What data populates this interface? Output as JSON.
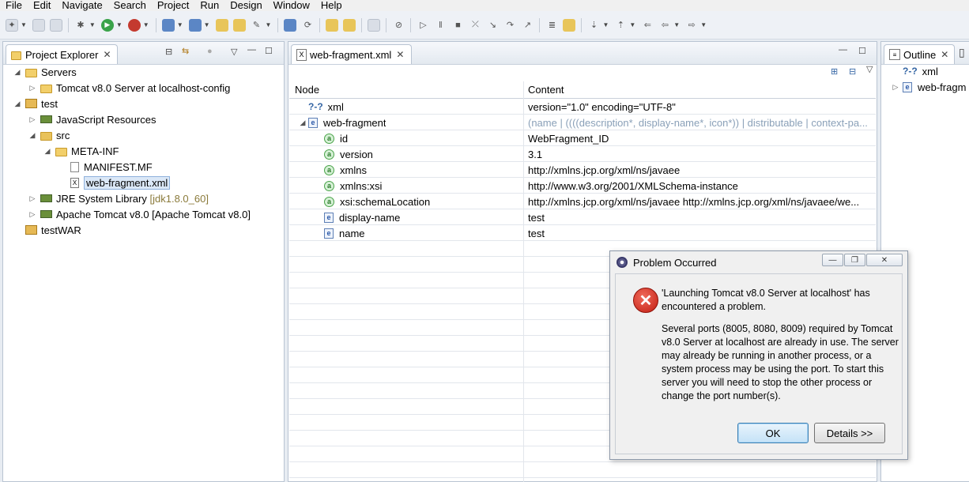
{
  "menu": [
    "File",
    "Edit",
    "Navigate",
    "Search",
    "Project",
    "Run",
    "Design",
    "Window",
    "Help"
  ],
  "project_explorer": {
    "tab_label": "Project Explorer",
    "tree": [
      {
        "label": "Servers",
        "level": 0,
        "expanded": true,
        "icon": "folder-icon"
      },
      {
        "label": "Tomcat v8.0 Server at localhost-config",
        "level": 1,
        "expanded": false,
        "icon": "folder-icon"
      },
      {
        "label": "test",
        "level": 0,
        "expanded": true,
        "icon": "project-icon"
      },
      {
        "label": "JavaScript Resources",
        "level": 1,
        "expanded": false,
        "icon": "library-icon"
      },
      {
        "label": "src",
        "level": 1,
        "expanded": true,
        "icon": "source-folder-icon"
      },
      {
        "label": "META-INF",
        "level": 2,
        "expanded": true,
        "icon": "folder-icon"
      },
      {
        "label": "MANIFEST.MF",
        "level": 3,
        "icon": "file-icon"
      },
      {
        "label": "web-fragment.xml",
        "level": 3,
        "icon": "xml-file-icon",
        "selected": true
      },
      {
        "label": "JRE System Library",
        "decoration": "[jdk1.8.0_60]",
        "level": 1,
        "expanded": false,
        "icon": "library-icon"
      },
      {
        "label": "Apache Tomcat v8.0 [Apache Tomcat v8.0]",
        "level": 1,
        "expanded": false,
        "icon": "library-icon"
      },
      {
        "label": "testWAR",
        "level": 0,
        "icon": "project-icon"
      }
    ]
  },
  "editor": {
    "tab_label": "web-fragment.xml",
    "col_node": "Node",
    "col_content": "Content",
    "rows": [
      {
        "node": "xml",
        "content": "version=\"1.0\" encoding=\"UTF-8\"",
        "kind": "pi",
        "indent": 0
      },
      {
        "node": "web-fragment",
        "content": "(name | ((((description*, display-name*, icon*)) | distributable | context-pa...",
        "kind": "element",
        "indent": 0,
        "expanded": true,
        "hint": true
      },
      {
        "node": "id",
        "content": "WebFragment_ID",
        "kind": "attr",
        "indent": 1
      },
      {
        "node": "version",
        "content": "3.1",
        "kind": "attr",
        "indent": 1
      },
      {
        "node": "xmlns",
        "content": "http://xmlns.jcp.org/xml/ns/javaee",
        "kind": "attr",
        "indent": 1
      },
      {
        "node": "xmlns:xsi",
        "content": "http://www.w3.org/2001/XMLSchema-instance",
        "kind": "attr",
        "indent": 1
      },
      {
        "node": "xsi:schemaLocation",
        "content": "http://xmlns.jcp.org/xml/ns/javaee http://xmlns.jcp.org/xml/ns/javaee/we...",
        "kind": "attr",
        "indent": 1
      },
      {
        "node": "display-name",
        "content": "test",
        "kind": "element",
        "indent": 1
      },
      {
        "node": "name",
        "content": "test",
        "kind": "element",
        "indent": 1
      }
    ]
  },
  "outline": {
    "tab_label": "Outline",
    "items": [
      {
        "label": "xml",
        "icon": "pi-icon"
      },
      {
        "label": "web-fragm",
        "icon": "element-icon"
      }
    ]
  },
  "dialog": {
    "title": "Problem Occurred",
    "message": "'Launching Tomcat v8.0 Server at localhost' has encountered a problem.",
    "detail": "Several ports (8005, 8080, 8009) required by Tomcat v8.0 Server at localhost are already in use. The server may already be running in another process, or a system process may be using the port. To start this server you will need to stop the other process or change the port number(s).",
    "ok_label": "OK",
    "details_label": "Details >>"
  },
  "colors": {
    "accent": "#3c7fb1",
    "error": "#c21d12",
    "decoration": "#8a7a3a",
    "hint": "#8aa0b8"
  }
}
